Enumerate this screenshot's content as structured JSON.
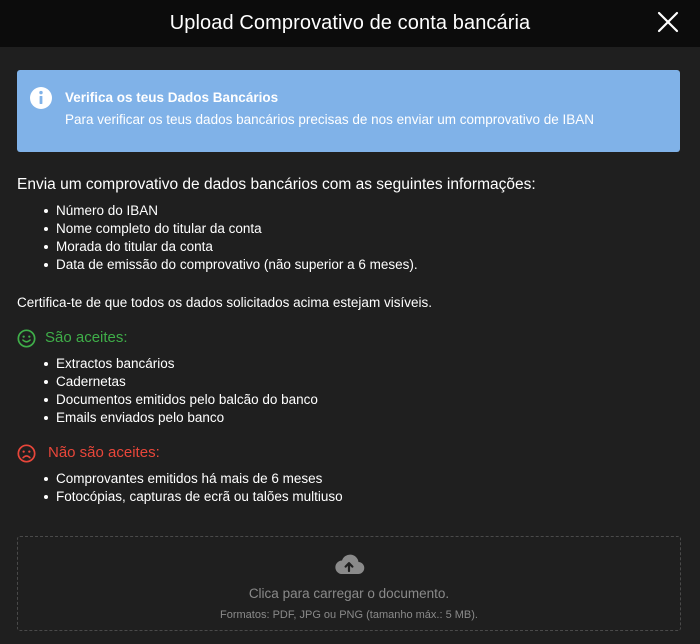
{
  "header": {
    "title": "Upload Comprovativo de conta bancária"
  },
  "alert": {
    "title": "Verifica os teus Dados Bancários",
    "description": "Para verificar os teus dados bancários precisas de nos enviar um comprovativo de IBAN"
  },
  "intro": "Envia um comprovativo de dados bancários com as seguintes informações:",
  "requirements": [
    "Número do IBAN",
    "Nome completo do titular da conta",
    "Morada do titular da conta",
    "Data de emissão do comprovativo (não superior a 6 meses)."
  ],
  "note": "Certifica-te de que todos os dados solicitados acima estejam visíveis.",
  "accepted": {
    "label": "São aceites:",
    "items": [
      "Extractos bancários",
      "Cadernetas",
      "Documentos emitidos pelo balcão do banco",
      "Emails enviados pelo banco"
    ]
  },
  "rejected": {
    "label": "Não são aceites:",
    "items": [
      "Comprovantes emitidos há mais de 6 meses",
      "Fotocópias, capturas de ecrã ou talões multiuso"
    ]
  },
  "dropzone": {
    "main": "Clica para carregar o documento.",
    "sub": "Formatos: PDF, JPG ou PNG (tamanho máx.: 5 MB)."
  },
  "colors": {
    "header_bg": "#0c0c0c",
    "body_bg": "#1f1f1f",
    "alert_bg": "#80b2e8",
    "accepted": "#3fae49",
    "rejected": "#e8463a",
    "muted": "#8a8a8a"
  },
  "icons": {
    "close": "close-icon",
    "alert": "info-icon",
    "accepted": "smile-icon",
    "rejected": "sad-icon",
    "upload": "cloud-upload-icon"
  }
}
